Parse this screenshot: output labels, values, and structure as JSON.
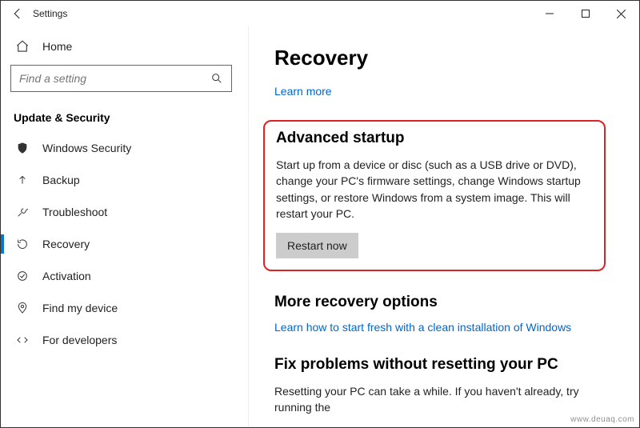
{
  "window": {
    "title": "Settings"
  },
  "sidebar": {
    "home_label": "Home",
    "search_placeholder": "Find a setting",
    "section_header": "Update & Security",
    "items": [
      {
        "label": "Windows Security"
      },
      {
        "label": "Backup"
      },
      {
        "label": "Troubleshoot"
      },
      {
        "label": "Recovery"
      },
      {
        "label": "Activation"
      },
      {
        "label": "Find my device"
      },
      {
        "label": "For developers"
      }
    ]
  },
  "page": {
    "title": "Recovery",
    "learn_more": "Learn more",
    "advanced_startup": {
      "heading": "Advanced startup",
      "body": "Start up from a device or disc (such as a USB drive or DVD), change your PC's firmware settings, change Windows startup settings, or restore Windows from a system image. This will restart your PC.",
      "button": "Restart now"
    },
    "more_options": {
      "heading": "More recovery options",
      "link": "Learn how to start fresh with a clean installation of Windows"
    },
    "fix_problems": {
      "heading": "Fix problems without resetting your PC",
      "body": "Resetting your PC can take a while. If you haven't already, try running the"
    }
  },
  "watermark": "www.deuaq.com"
}
